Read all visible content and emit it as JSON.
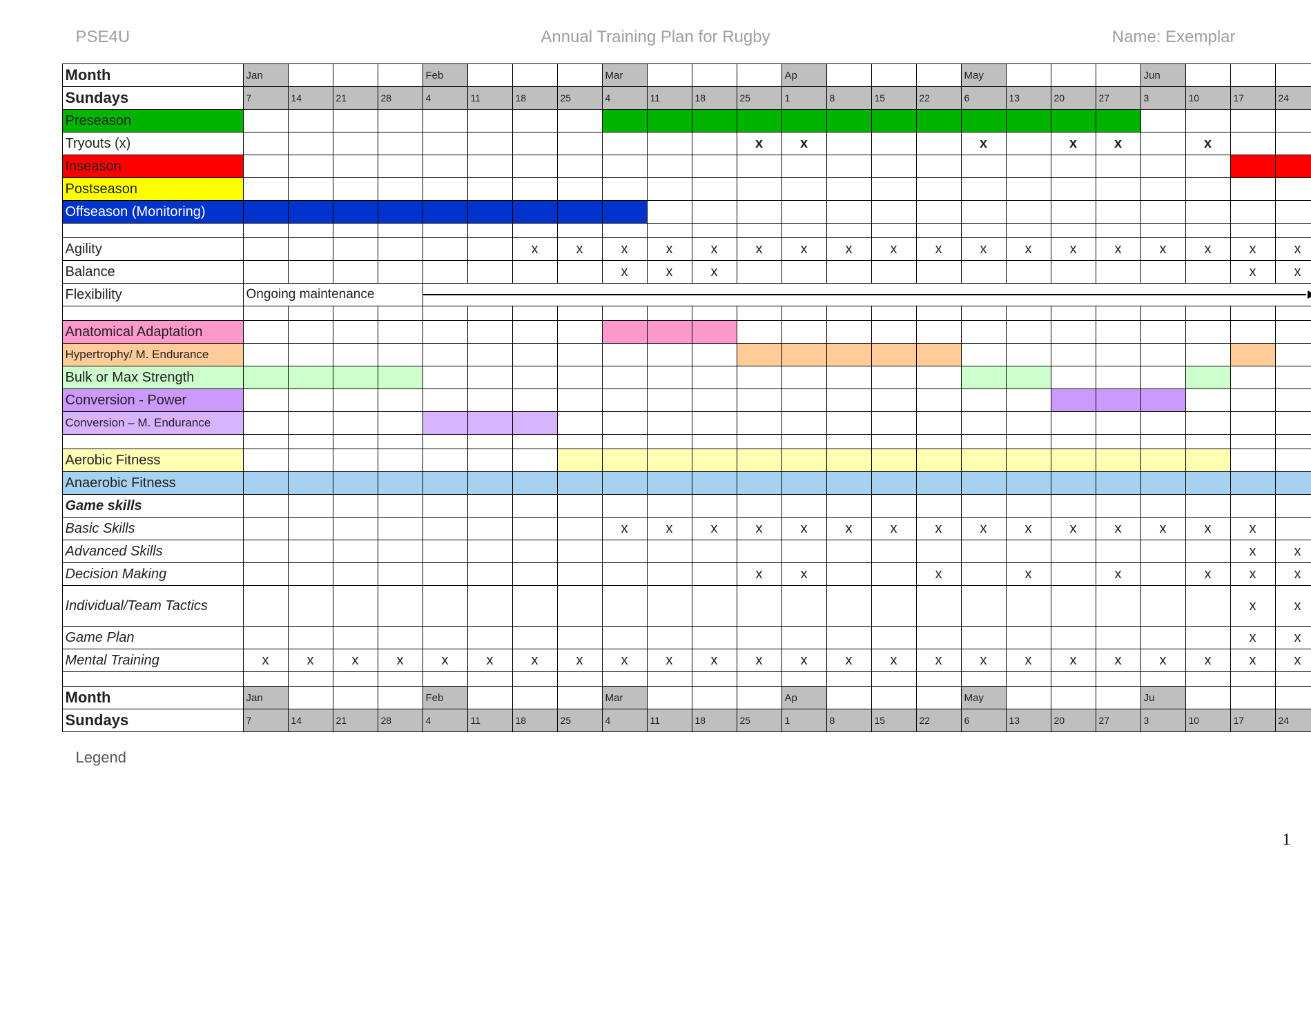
{
  "header": {
    "left": "PSE4U",
    "center": "Annual Training Plan for Rugby",
    "right": "Name: Exemplar"
  },
  "legend": "Legend",
  "pagenum": "1",
  "months": [
    "Jan",
    "",
    "",
    "",
    "Feb",
    "",
    "",
    "",
    "M\nar",
    "",
    "",
    "",
    "Ap",
    "",
    "",
    "",
    "May",
    "",
    "",
    "",
    "Jun",
    "",
    "",
    ""
  ],
  "sundays": [
    "7",
    "14",
    "21",
    "28",
    "4",
    "11",
    "18",
    "25",
    "4",
    "11",
    "18",
    "25",
    "1",
    "8",
    "15",
    "22",
    "6",
    "13",
    "20",
    "27",
    "3",
    "10",
    "17",
    "24"
  ],
  "footer_months": [
    "Jan",
    "",
    "",
    "",
    "Feb",
    "",
    "",
    "",
    "M\nar",
    "",
    "",
    "",
    "Ap",
    "",
    "",
    "",
    "May",
    "",
    "",
    "",
    "Ju",
    "",
    "",
    ""
  ],
  "labels": {
    "month": "Month",
    "sundays": "Sundays",
    "preseason": "Preseason",
    "tryouts": "Tryouts (x)",
    "inseason": "Inseason",
    "postseason": "Postseason",
    "offseason": "Offseason (Monitoring)",
    "agility": "Agility",
    "balance": "Balance",
    "flexibility": "Flexibility",
    "flex_note": "Ongoing maintenance",
    "aa": "Anatomical Adaptation",
    "hyp": "Hypertrophy/ M. Endurance",
    "bulk": "Bulk or Max Strength",
    "convp": "Conversion - Power",
    "convm": "Conversion – M. Endurance",
    "aerobic": "Aerobic Fitness",
    "anaerobic": "Anaerobic Fitness",
    "gameskills": "Game skills",
    "basic": "Basic Skills",
    "advanced": "Advanced Skills",
    "decision": "Decision Making",
    "tactics": "Individual/Team Tactics",
    "gameplan": "Game Plan",
    "mental": "Mental Training"
  },
  "colors": {
    "green": "#00b400",
    "red": "#ff0000",
    "yellow": "#ffff00",
    "blue": "#0033cc",
    "pink": "#ff99cc",
    "orange": "#ffcc99",
    "lgreen": "#ccffcc",
    "purple": "#cc99ff",
    "lpurple": "#d8b3ff",
    "lyellow": "#ffffb3",
    "lblue": "#a6d1f0",
    "grey": "#bfbfbf"
  },
  "rows": [
    {
      "id": "preseason",
      "label": "preseason",
      "labelbg": "green",
      "cells": [
        {
          "s": 8,
          "e": 19,
          "bg": "green"
        }
      ]
    },
    {
      "id": "tryouts",
      "label": "tryouts",
      "marks": [
        11,
        12,
        16,
        18,
        19,
        21
      ],
      "bold": true
    },
    {
      "id": "inseason",
      "label": "inseason",
      "labelbg": "red",
      "cells": [
        {
          "s": 22,
          "e": 23,
          "bg": "red"
        }
      ]
    },
    {
      "id": "postseason",
      "label": "postseason",
      "labelbg": "yellow"
    },
    {
      "id": "offseason",
      "label": "offseason",
      "labelbg": "blue",
      "labelcolor": "#fff",
      "cells": [
        {
          "s": 0,
          "e": 8,
          "bg": "blue"
        }
      ]
    },
    {
      "id": "blank1",
      "blank": true
    },
    {
      "id": "agility",
      "label": "agility",
      "marks": [
        6,
        7,
        8,
        9,
        10,
        11,
        12,
        13,
        14,
        15,
        16,
        17,
        18,
        19,
        20,
        21,
        22,
        23
      ]
    },
    {
      "id": "balance",
      "label": "balance",
      "marks": [
        8,
        9,
        10,
        22,
        23
      ]
    },
    {
      "id": "flexibility",
      "label": "flexibility",
      "note": "flex_note",
      "arrow": true
    },
    {
      "id": "blank2",
      "blank": true
    },
    {
      "id": "aa",
      "label": "aa",
      "labelbg": "pink",
      "cells": [
        {
          "s": 8,
          "e": 10,
          "bg": "pink"
        }
      ]
    },
    {
      "id": "hyp",
      "label": "hyp",
      "labelbg": "orange",
      "fs": 17,
      "cells": [
        {
          "s": 11,
          "e": 15,
          "bg": "orange"
        },
        {
          "s": 22,
          "e": 22,
          "bg": "orange"
        }
      ]
    },
    {
      "id": "bulk",
      "label": "bulk",
      "labelbg": "lgreen",
      "cells": [
        {
          "s": 0,
          "e": 3,
          "bg": "lgreen"
        },
        {
          "s": 16,
          "e": 17,
          "bg": "lgreen"
        },
        {
          "s": 21,
          "e": 21,
          "bg": "lgreen"
        }
      ]
    },
    {
      "id": "convp",
      "label": "convp",
      "labelbg": "purple",
      "cells": [
        {
          "s": 18,
          "e": 20,
          "bg": "purple"
        }
      ]
    },
    {
      "id": "convm",
      "label": "convm",
      "labelbg": "lpurple",
      "fs": 17,
      "cells": [
        {
          "s": 4,
          "e": 6,
          "bg": "lpurple"
        }
      ]
    },
    {
      "id": "blank3",
      "blank": true
    },
    {
      "id": "aerobic",
      "label": "aerobic",
      "labelbg": "lyellow",
      "cells": [
        {
          "s": 7,
          "e": 21,
          "bg": "lyellow"
        }
      ]
    },
    {
      "id": "anaerobic",
      "label": "anaerobic",
      "labelbg": "lblue",
      "cells": [
        {
          "s": 0,
          "e": 23,
          "bg": "lblue"
        }
      ]
    },
    {
      "id": "gameskills",
      "label": "gameskills",
      "bolditalic": true
    },
    {
      "id": "basic",
      "label": "basic",
      "italic": true,
      "marks": [
        8,
        9,
        10,
        11,
        12,
        13,
        14,
        15,
        16,
        17,
        18,
        19,
        20,
        21,
        22
      ]
    },
    {
      "id": "advanced",
      "label": "advanced",
      "italic": true,
      "marks": [
        22,
        23
      ]
    },
    {
      "id": "decision",
      "label": "decision",
      "italic": true,
      "marks": [
        11,
        12,
        15,
        17,
        19,
        21,
        22,
        23
      ]
    },
    {
      "id": "tactics",
      "label": "tactics",
      "italic": true,
      "tall": true,
      "marks": [
        22,
        23
      ]
    },
    {
      "id": "gameplan",
      "label": "gameplan",
      "italic": true,
      "marks": [
        22,
        23
      ]
    },
    {
      "id": "mental",
      "label": "mental",
      "italic": true,
      "marks": [
        0,
        1,
        2,
        3,
        4,
        5,
        6,
        7,
        8,
        9,
        10,
        11,
        12,
        13,
        14,
        15,
        16,
        17,
        18,
        19,
        20,
        21,
        22,
        23
      ]
    },
    {
      "id": "blank4",
      "blank": true
    }
  ]
}
